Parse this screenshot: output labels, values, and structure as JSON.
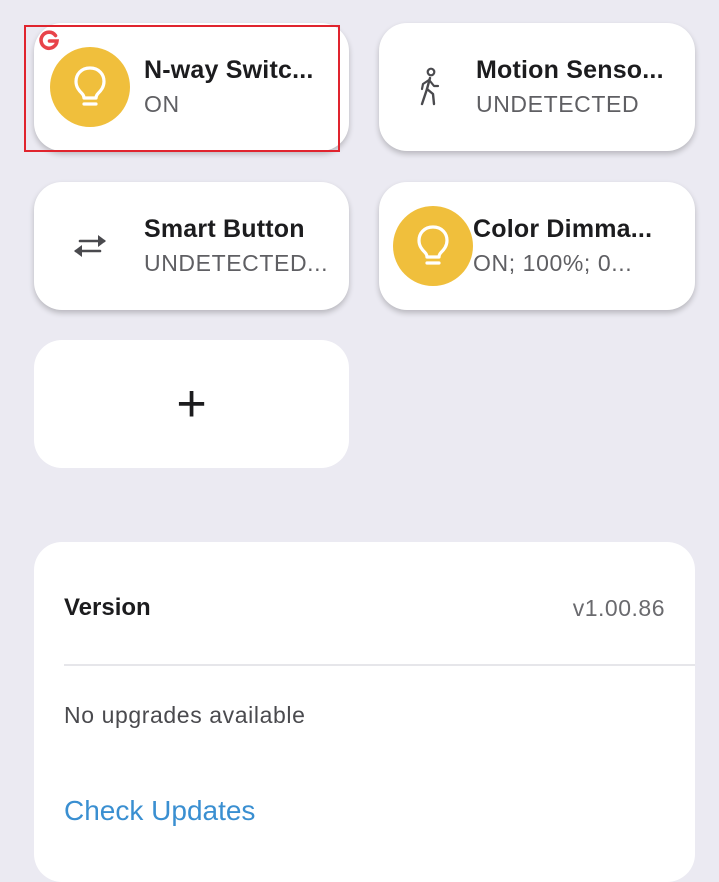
{
  "devices": [
    {
      "name": "N-way Switc...",
      "status": "ON",
      "icon": "lightbulb-icon"
    },
    {
      "name": "Motion Senso...",
      "status": "UNDETECTED",
      "icon": "walking-person-icon"
    },
    {
      "name": "Smart Button",
      "status": "UNDETECTED...",
      "icon": "swap-arrows-icon"
    },
    {
      "name": "Color Dimma...",
      "status": "ON; 100%; 0...",
      "icon": "lightbulb-icon"
    }
  ],
  "add_button": {
    "label": "+"
  },
  "version_card": {
    "label": "Version",
    "value": "v1.00.86",
    "message": "No upgrades available",
    "check_label": "Check Updates"
  },
  "colors": {
    "background": "#ebeaf2",
    "bulb": "#f0bf3c",
    "highlight": "#e0242e",
    "link": "#3a8fd1"
  }
}
